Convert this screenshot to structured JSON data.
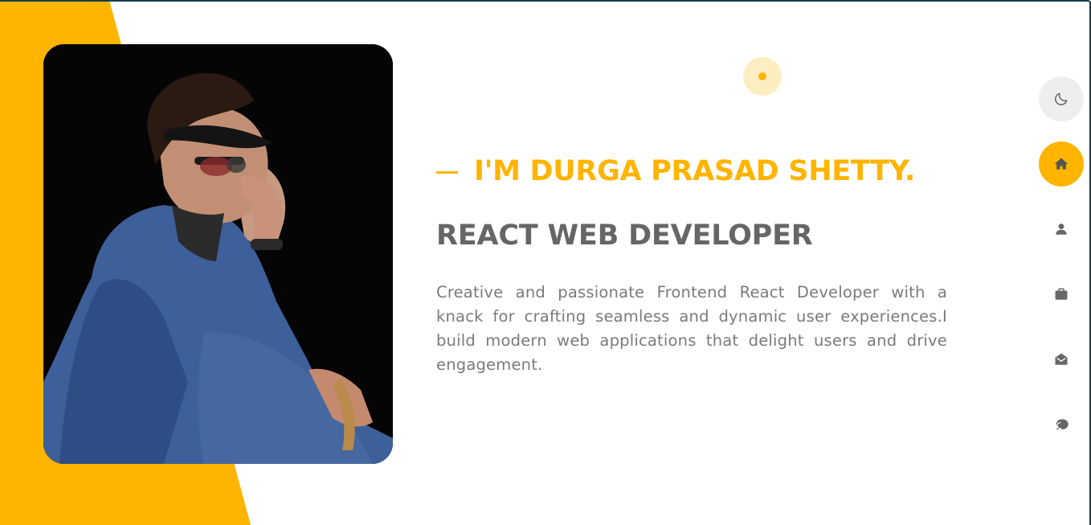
{
  "colors": {
    "accent": "#ffb400",
    "heading_gray": "#666666",
    "body_gray": "#7a7a7a",
    "icon_gray": "#666666"
  },
  "hero": {
    "intro_heading": "I'M DURGA PRASAD SHETTY.",
    "role_heading": "REACT WEB DEVELOPER",
    "bio": "Creative and passionate Frontend React Developer with a knack for crafting seamless and dynamic user experiences.I build modern web applications that delight users and drive engagement."
  },
  "nav": {
    "theme_toggle": {
      "icon": "moon-icon"
    },
    "items": [
      {
        "id": "home",
        "icon": "home-icon",
        "active": true
      },
      {
        "id": "about",
        "icon": "user-icon",
        "active": false
      },
      {
        "id": "portfolio",
        "icon": "briefcase-icon",
        "active": false
      },
      {
        "id": "contact",
        "icon": "envelope-open-icon",
        "active": false
      },
      {
        "id": "blog",
        "icon": "comments-icon",
        "active": false
      }
    ]
  }
}
